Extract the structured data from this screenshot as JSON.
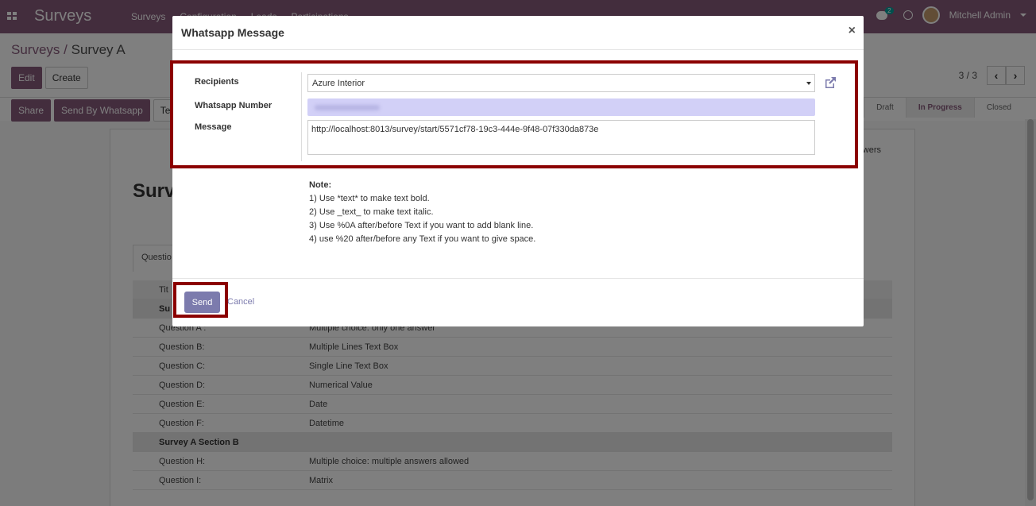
{
  "navbar": {
    "brand": "Surveys",
    "menu": [
      "Surveys",
      "Configuration",
      "Leads",
      "Participations"
    ],
    "chat_badge": "2",
    "user": "Mitchell Admin"
  },
  "control_panel": {
    "breadcrumb_parent": "Surveys",
    "breadcrumb_sep": "/",
    "breadcrumb_current": "Survey A",
    "edit_label": "Edit",
    "create_label": "Create",
    "pager_value": "3 / 3",
    "share_label": "Share",
    "send_whatsapp_label": "Send By Whatsapp",
    "test_label": "Tes",
    "stages": [
      "Draft",
      "In Progress",
      "Closed"
    ]
  },
  "sheet": {
    "title": "Surv",
    "answers_label": "wers",
    "tab_label": "Questio",
    "rows": [
      {
        "type": "section",
        "title": "Su",
        "value": ""
      },
      {
        "type": "question",
        "title": "Question A :",
        "value": "Multiple choice: only one answer"
      },
      {
        "type": "question",
        "title": "Question B:",
        "value": "Multiple Lines Text Box"
      },
      {
        "type": "question",
        "title": "Question C:",
        "value": "Single Line Text Box"
      },
      {
        "type": "question",
        "title": "Question D:",
        "value": "Numerical Value"
      },
      {
        "type": "question",
        "title": "Question E:",
        "value": "Date"
      },
      {
        "type": "question",
        "title": "Question F:",
        "value": "Datetime"
      },
      {
        "type": "section",
        "title": "Survey A Section B",
        "value": ""
      },
      {
        "type": "question",
        "title": "Question H:",
        "value": "Multiple choice: multiple answers allowed"
      },
      {
        "type": "question",
        "title": "Question I:",
        "value": "Matrix"
      }
    ],
    "header_col": "Tit"
  },
  "modal": {
    "title": "Whatsapp Message",
    "close_glyph": "×",
    "recipients_label": "Recipients",
    "recipients_value": "Azure Interior",
    "whatsapp_number_label": "Whatsapp Number",
    "message_label": "Message",
    "message_value": "http://localhost:8013/survey/start/5571cf78-19c3-444e-9f48-07f330da873e",
    "note_title": "Note:",
    "note_lines": [
      "1) Use *text* to make text bold.",
      "2) Use _text_ to make text italic.",
      "3) Use %0A after/before Text if you want to add blank line.",
      "4) use %20 after/before any Text if you want to give space."
    ],
    "send_label": "Send",
    "cancel_label": "Cancel"
  },
  "colors": {
    "brand": "#875a7b",
    "send_button": "#7c7bad",
    "highlight": "#8b0000"
  }
}
